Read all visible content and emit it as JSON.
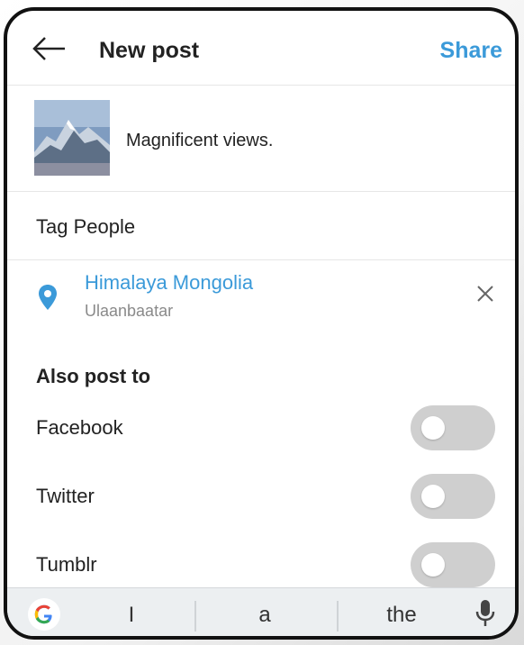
{
  "header": {
    "title": "New post",
    "share_label": "Share"
  },
  "post": {
    "caption": "Magnificent views."
  },
  "tag_people": {
    "label": "Tag People"
  },
  "location": {
    "name": "Himalaya Mongolia",
    "subtitle": "Ulaanbaatar"
  },
  "also_post": {
    "heading": "Also post to",
    "items": [
      {
        "label": "Facebook",
        "enabled": false
      },
      {
        "label": "Twitter",
        "enabled": false
      },
      {
        "label": "Tumblr",
        "enabled": false
      }
    ]
  },
  "keyboard": {
    "suggestions": [
      "I",
      "a",
      "the"
    ]
  },
  "colors": {
    "accent": "#3b9ad9",
    "toggle_off": "#cfcfcf",
    "keyboard_bg": "#eceff1"
  },
  "icons": [
    "back-arrow-icon",
    "location-pin-icon",
    "close-icon",
    "google-icon",
    "microphone-icon"
  ]
}
